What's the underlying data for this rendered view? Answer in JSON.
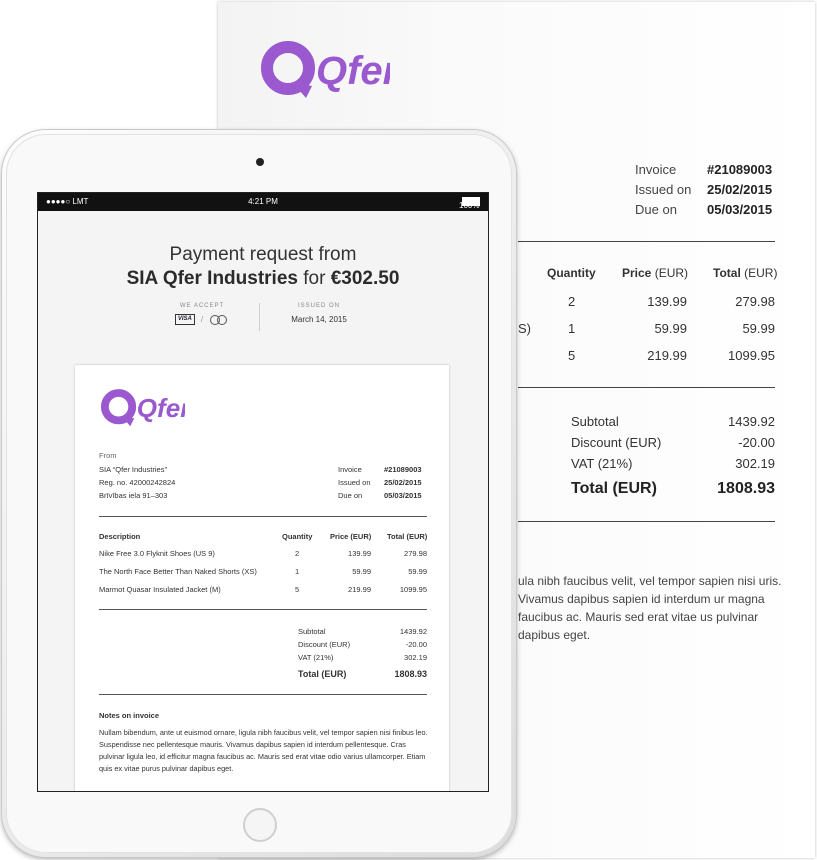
{
  "brand": {
    "name": "Qfer",
    "color": "#9b59d0"
  },
  "paper": {
    "meta": [
      {
        "k": "Invoice",
        "v": "#21089003"
      },
      {
        "k": "Issued on",
        "v": "25/02/2015"
      },
      {
        "k": "Due on",
        "v": "05/03/2015"
      }
    ],
    "headers": {
      "quantity": "Quantity",
      "price": "Price",
      "price_unit": "(EUR)",
      "total": "Total",
      "total_unit": "(EUR)"
    },
    "rows": [
      {
        "desc_fragment": "",
        "qty": "2",
        "price": "139.99",
        "total": "279.98"
      },
      {
        "desc_fragment": "S)",
        "qty": "1",
        "price": "59.99",
        "total": "59.99"
      },
      {
        "desc_fragment": "",
        "qty": "5",
        "price": "219.99",
        "total": "1099.95"
      }
    ],
    "summary": [
      {
        "k": "Subtotal",
        "v": "1439.92"
      },
      {
        "k": "Discount (EUR)",
        "v": "-20.00"
      },
      {
        "k": "VAT (21%)",
        "v": "302.19"
      }
    ],
    "total": {
      "k": "Total (EUR)",
      "v": "1808.93"
    },
    "notes": "ula nibh faucibus velit, vel tempor sapien nisi uris. Vivamus dapibus sapien id interdum ur magna faucibus ac. Mauris sed erat vitae us pulvinar dapibus eget."
  },
  "ipad": {
    "status": {
      "carrier": "●●●●○ LMT",
      "time": "4:21 PM",
      "battery": "100%"
    },
    "request": {
      "line1": "Payment request from",
      "company": "SIA Qfer Industries",
      "for_word": "for",
      "amount": "€302.50",
      "we_accept": "WE ACCEPT",
      "visa": "VISA",
      "slash": "/",
      "issued_label": "ISSUED ON",
      "issued_value": "March 14, 2015"
    },
    "invoice": {
      "from_label": "From",
      "company": "SIA “Qfer Industries”",
      "reg": "Reg. no. 42000242824",
      "address": "Brīvības iela 91–303",
      "meta": [
        {
          "k": "Invoice",
          "v": "#21089003"
        },
        {
          "k": "Issued on",
          "v": "25/02/2015"
        },
        {
          "k": "Due on",
          "v": "05/03/2015"
        }
      ],
      "headers": {
        "desc": "Description",
        "qty": "Quantity",
        "price": "Price (EUR)",
        "total": "Total (EUR)"
      },
      "rows": [
        {
          "desc": "Nike Free 3.0 Flyknit Shoes (US 9)",
          "qty": "2",
          "price": "139.99",
          "total": "279.98"
        },
        {
          "desc": "The North Face Better Than Naked Shorts (XS)",
          "qty": "1",
          "price": "59.99",
          "total": "59.99"
        },
        {
          "desc": "Marmot Quasar Insulated Jacket (M)",
          "qty": "5",
          "price": "219.99",
          "total": "1099.95"
        }
      ],
      "summary": [
        {
          "k": "Subtotal",
          "v": "1439.92"
        },
        {
          "k": "Discount (EUR)",
          "v": "-20.00"
        },
        {
          "k": "VAT (21%)",
          "v": "302.19"
        }
      ],
      "total": {
        "k": "Total (EUR)",
        "v": "1808.93"
      },
      "notes_title": "Notes on invoice",
      "notes": "Nullam bibendum, ante ut euismod ornare, ligula nibh faucibus velit, vel tempor sapien nisi finibus leo. Suspendisse nec pellentesque mauris. Vivamus dapibus sapien id interdum pellentesque. Cras pulvinar ligula leo, id efficitur magna faucibus ac. Mauris sed erat vitae odio varius ullamcorper. Etiam quis ex vitae purus pulvinar dapibus eget."
    }
  }
}
